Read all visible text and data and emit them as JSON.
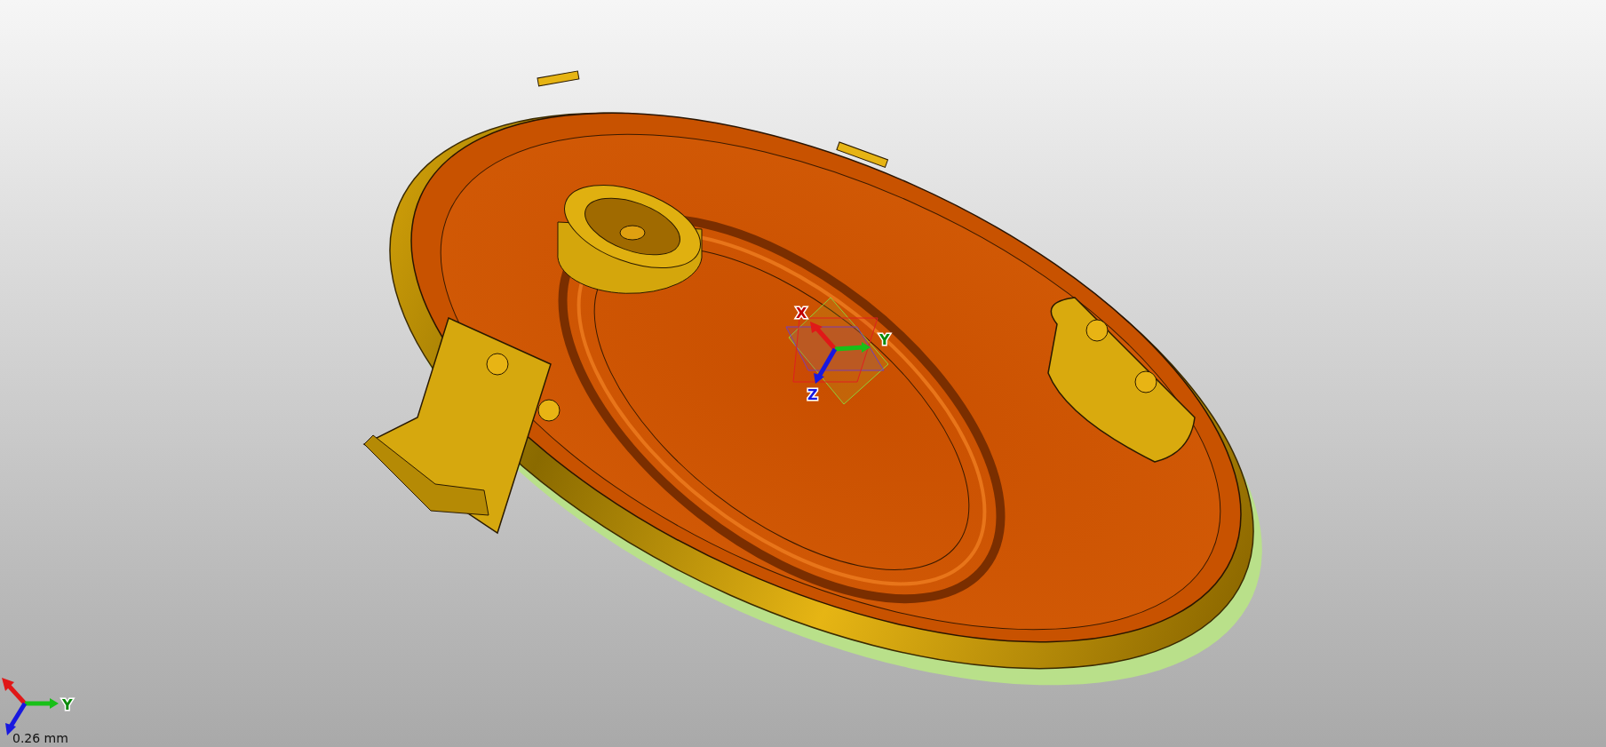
{
  "viewport": {
    "center_triad": {
      "labels": [
        "X",
        "Y",
        "Z"
      ]
    },
    "corner_triad": {
      "labels": [
        "Y"
      ]
    },
    "scale_label": "0.26 mm"
  }
}
